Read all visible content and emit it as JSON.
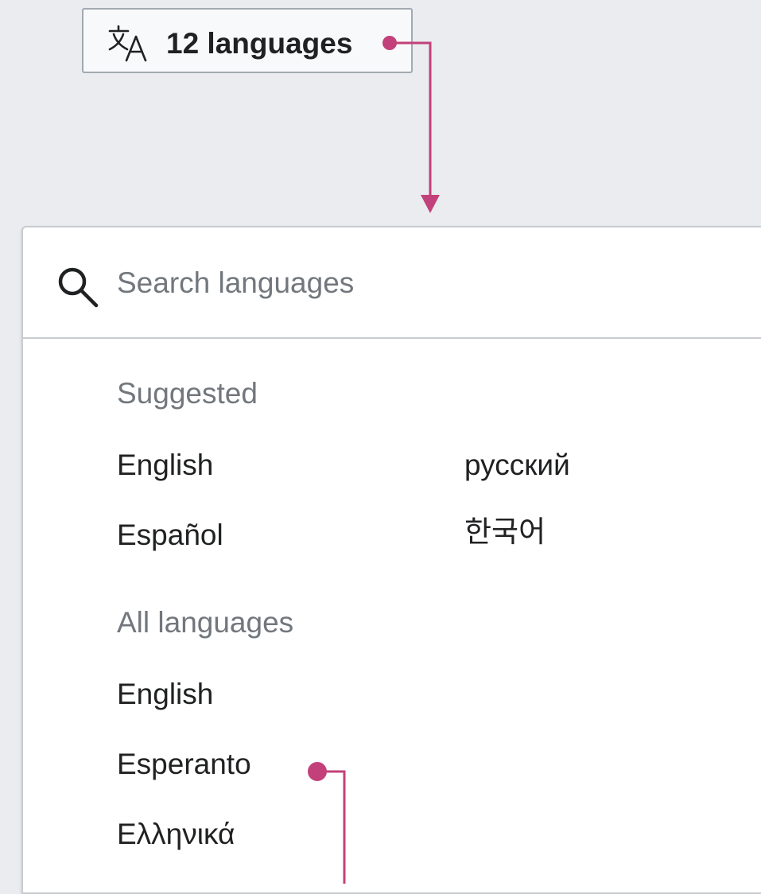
{
  "language_button": {
    "label": "12 languages",
    "icon": "translate-icon"
  },
  "search": {
    "placeholder": "Search languages",
    "value": "",
    "icon": "search-icon"
  },
  "suggested": {
    "heading": "Suggested",
    "items": [
      "English",
      "русский",
      "Español",
      "한국어"
    ]
  },
  "all_languages": {
    "heading": "All languages",
    "items": [
      "English",
      "Esperanto",
      "Ελληνικά"
    ]
  },
  "colors": {
    "accent": "#c2417a",
    "background": "#eaecf0",
    "border": "#c8ccd1"
  }
}
